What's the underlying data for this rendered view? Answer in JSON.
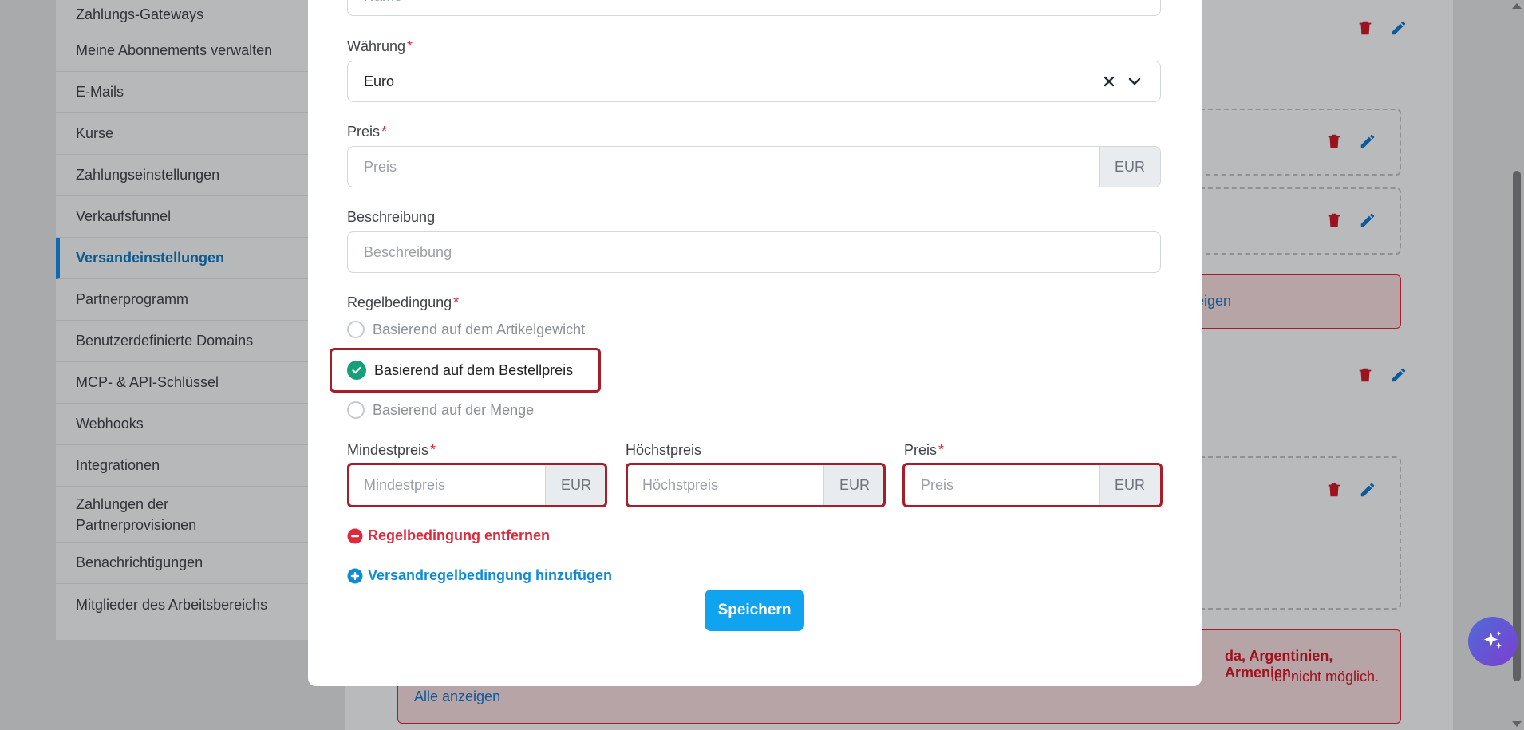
{
  "sidebar": {
    "items": [
      {
        "label": "Zahlungs-Gateways"
      },
      {
        "label": "Meine Abonnements verwalten"
      },
      {
        "label": "E-Mails"
      },
      {
        "label": "Kurse"
      },
      {
        "label": "Zahlungseinstellungen"
      },
      {
        "label": "Verkaufsfunnel"
      },
      {
        "label": "Versandeinstellungen"
      },
      {
        "label": "Partnerprogramm"
      },
      {
        "label": "Benutzerdefinierte Domains"
      },
      {
        "label": "MCP- & API-Schlüssel"
      },
      {
        "label": "Webhooks"
      },
      {
        "label": "Integrationen"
      },
      {
        "label": "Zahlungen der Partnerprovisionen"
      },
      {
        "label": "Benachrichtigungen"
      },
      {
        "label": "Mitglieder des Arbeitsbereichs"
      }
    ]
  },
  "background": {
    "alert_link_partial": "eigen",
    "error_text_line1": "da, Argentinien, Armenien,",
    "error_text_line2": "ler nicht möglich.",
    "show_all_link": "Alle anzeigen"
  },
  "modal": {
    "name_placeholder": "Name",
    "currency": {
      "label": "Währung",
      "required": "*",
      "value": "Euro"
    },
    "price": {
      "label": "Preis",
      "required": "*",
      "placeholder": "Preis",
      "addon": "EUR"
    },
    "description": {
      "label": "Beschreibung",
      "placeholder": "Beschreibung"
    },
    "rule": {
      "label": "Regelbedingung",
      "required": "*",
      "options": [
        {
          "label": "Basierend auf dem Artikelgewicht",
          "selected": false
        },
        {
          "label": "Basierend auf dem Bestellpreis",
          "selected": true
        },
        {
          "label": "Basierend auf der Menge",
          "selected": false
        }
      ]
    },
    "min_price": {
      "label": "Mindestpreis",
      "required": "*",
      "placeholder": "Mindestpreis",
      "addon": "EUR"
    },
    "max_price": {
      "label": "Höchstpreis",
      "placeholder": "Höchstpreis",
      "addon": "EUR"
    },
    "rule_price": {
      "label": "Preis",
      "required": "*",
      "placeholder": "Preis",
      "addon": "EUR"
    },
    "remove_rule": "Regelbedingung entfernen",
    "add_rule": "Versandregelbedingung hinzufügen",
    "save": "Speichern"
  },
  "colors": {
    "accent": "#0fa3f0",
    "danger": "#e0283c",
    "success": "#16a07a",
    "highlight": "#a71d2a"
  },
  "icons": [
    "trash-icon",
    "pencil-icon",
    "close-icon",
    "chevron-down-icon",
    "check-icon",
    "minus-circle-icon",
    "plus-circle-icon",
    "sparkles-icon"
  ]
}
